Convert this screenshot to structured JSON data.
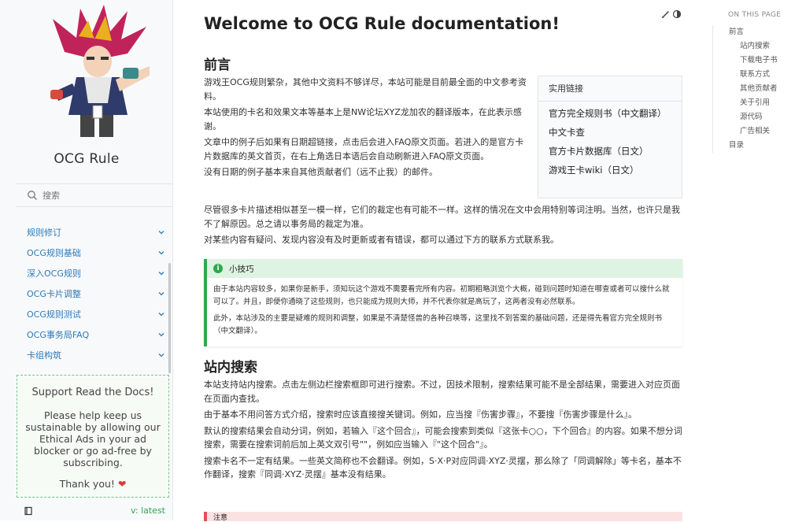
{
  "sidebar": {
    "site_title": "OCG Rule",
    "search_placeholder": "搜索",
    "nav_items": [
      {
        "label": "规则修订"
      },
      {
        "label": "OCG规则基础"
      },
      {
        "label": "深入OCG规则"
      },
      {
        "label": "OCG卡片调整"
      },
      {
        "label": "OCG规则测试"
      },
      {
        "label": "OCG事务局FAQ"
      },
      {
        "label": "卡组构筑"
      }
    ],
    "ad": {
      "title": "Support Read the Docs!",
      "body": "Please help keep us sustainable by allowing our Ethical Ads in your ad blocker or go ad-free by subscribing.",
      "thanks": "Thank you!"
    },
    "version": "v: latest",
    "colors": {
      "link": "#2b7bb9",
      "version": "#3aa14d"
    }
  },
  "main": {
    "title": "Welcome to OCG Rule documentation!",
    "section1": {
      "heading": "前言",
      "paragraphs": [
        "游戏王OCG规则繁杂，其他中文资料不够详尽，本站可能是目前最全面的中文参考资料。",
        "本站使用的卡名和效果文本等基本上是NW论坛XYZ龙加农的翻译版本，在此表示感谢。",
        "文章中的例子后如果有日期超链接，点击后会进入FAQ原文页面。若进入的是官方卡片数据库的英文首页，在右上角选日本语后会自动刷新进入FAQ原文页面。",
        "没有日期的例子基本来自其他贡献者们（远不止我）的邮件。",
        "尽管很多卡片描述相似甚至一模一样，它们的裁定也有可能不一样。这样的情况在文中会用特别等词注明。当然，也许只是我不了解原因。总之请以事务局的裁定为准。",
        "对某些内容有疑问、发现内容没有及时更新或者有错误，都可以通过下方的联系方式联系我。"
      ]
    },
    "links_box": {
      "heading": "实用链接",
      "links": [
        "官方完全规则书（中文翻译）",
        "中文卡查",
        "官方卡片数据库（日文）",
        "游戏王卡wiki（日文）"
      ]
    },
    "tip": {
      "heading": "小技巧",
      "paragraphs": [
        "由于本站内容较多，如果你是新手，须知玩这个游戏不需要看完所有内容。初期粗略浏览个大概，碰到问题时知道在哪查或者可以搜什么就可以了。并且，即便你通晓了这些规则，也只能成为规则大师，并不代表你就是高玩了，这两者没有必然联系。",
        "此外，本站涉及的主要是疑难的规则和调整，如果是不清楚怪兽的各种召唤等，这里找不到答案的基础问题，还是得先看官方完全规则书（中文翻译）。"
      ]
    },
    "section2": {
      "heading": "站内搜索",
      "paragraphs": [
        "本站支持站内搜索。点击左侧边栏搜索框即可进行搜索。不过，因技术限制，搜索结果可能不是全部结果，需要进入对应页面在页面内查找。",
        "由于基本不用问答方式介绍，搜索时应该直接搜关键词。例如，应当搜『伤害步骤』，不要搜『伤害步骤是什么』。",
        "默认的搜索结果会自动分词，例如，若输入『这个回合』，可能会搜索到类似『这张卡○○，下个回合』的内容。如果不想分词搜索，需要在搜索词前后加上英文双引号\"\"，例如应当输入『\"这个回合\"』。",
        "搜索卡名不一定有结果。一些英文简称也不会翻译。例如，S·X·P对应同调·XYZ·灵摆，那么除了「同调解除」等卡名，基本不作翻译，搜索『同调·XYZ·灵摆』基本没有结果。"
      ]
    },
    "warning_heading": "注意"
  },
  "toc": {
    "heading": "ON THIS PAGE",
    "items": [
      {
        "label": "前言",
        "level": 1
      },
      {
        "label": "站内搜索",
        "level": 2
      },
      {
        "label": "下载电子书",
        "level": 2
      },
      {
        "label": "联系方式",
        "level": 2
      },
      {
        "label": "其他贡献者",
        "level": 2
      },
      {
        "label": "关于引用",
        "level": 2
      },
      {
        "label": "源代码",
        "level": 2
      },
      {
        "label": "广告相关",
        "level": 2
      },
      {
        "label": "目录",
        "level": 1
      }
    ]
  }
}
